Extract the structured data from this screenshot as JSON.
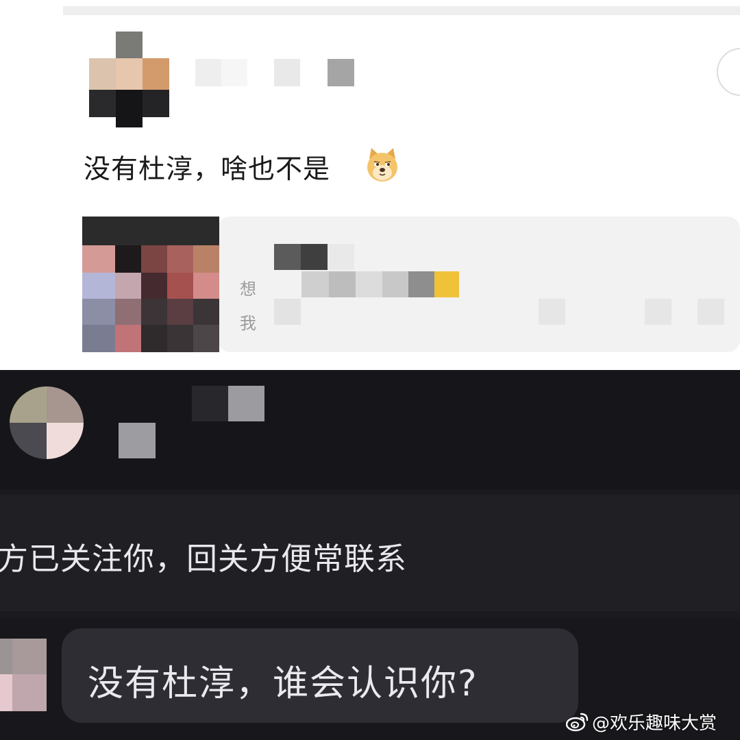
{
  "comment": {
    "text": "没有杜淳，啥也不是"
  },
  "quote_card": {
    "ghost_line1": "想",
    "ghost_line2": "我"
  },
  "notice": {
    "text": "方已关注你，回关方便常联系"
  },
  "reply": {
    "text": "没有杜淳，谁会认识你?"
  },
  "watermark": {
    "text": "@欢乐趣味大赏"
  },
  "icons": [
    "doge-emoji-icon",
    "weibo-logo-icon"
  ],
  "colors": {
    "light_bg": "#ffffff",
    "dark_bg": "#1b1b1f",
    "bubble_bg": "#2d2d33"
  }
}
